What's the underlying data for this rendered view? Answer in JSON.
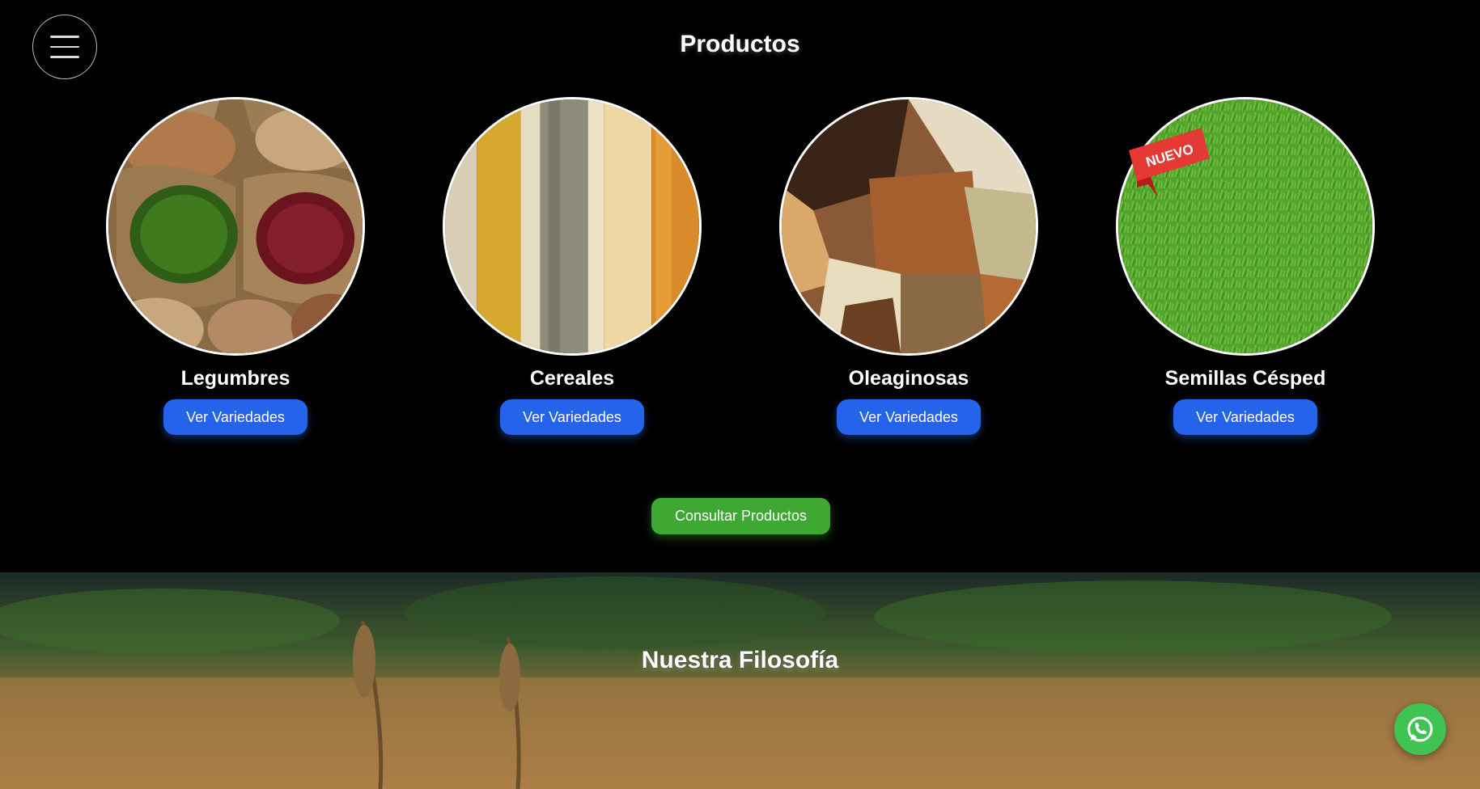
{
  "header": {
    "title": "Productos"
  },
  "menu": {
    "icon": "hamburger-menu-icon"
  },
  "products": [
    {
      "name": "Legumbres",
      "button": "Ver Variedades",
      "image": "legumes-sacks-image"
    },
    {
      "name": "Cereales",
      "button": "Ver Variedades",
      "image": "cereal-grains-image"
    },
    {
      "name": "Oleaginosas",
      "button": "Ver Variedades",
      "image": "nuts-seeds-image"
    },
    {
      "name": "Semillas Césped",
      "button": "Ver Variedades",
      "image": "grass-image",
      "badge": "NUEVO"
    }
  ],
  "cta": {
    "label": "Consultar Productos"
  },
  "philosophy": {
    "title": "Nuestra Filosofía",
    "image": "wheat-field-image"
  },
  "whatsapp": {
    "icon": "whatsapp-icon"
  },
  "colors": {
    "primary_button": "#2563eb",
    "cta_button": "#3ea832",
    "whatsapp": "#3fc352",
    "badge": "#e53935"
  }
}
